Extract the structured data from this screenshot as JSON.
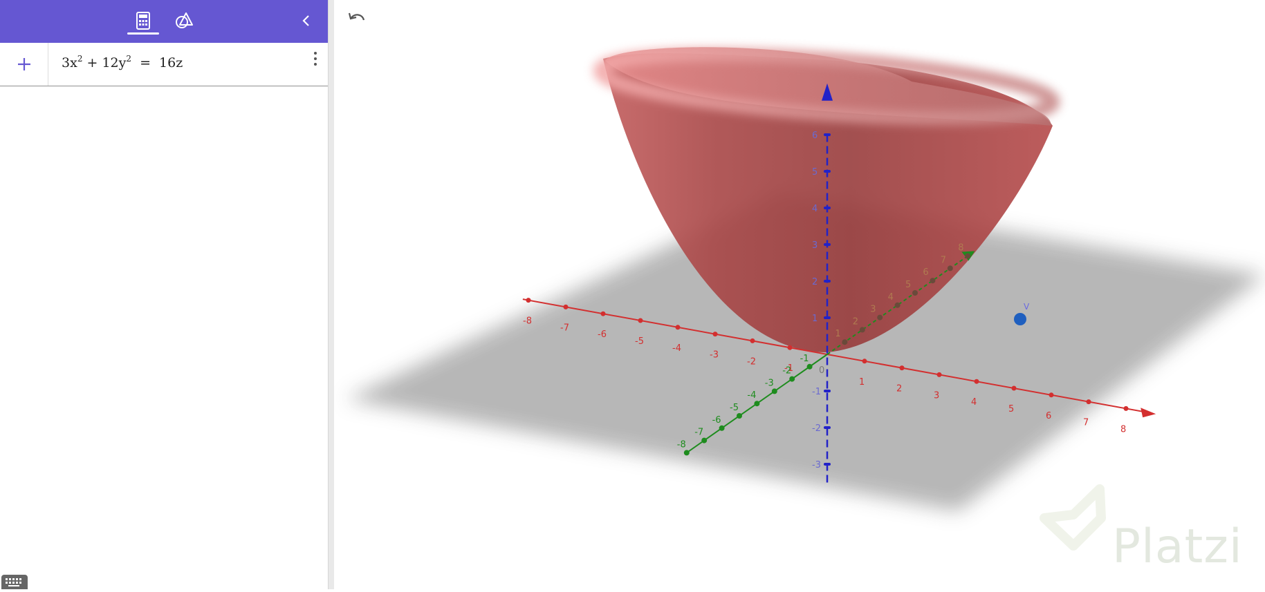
{
  "toolbar": {
    "tabs": [
      {
        "icon": "calculator-icon",
        "active": true
      },
      {
        "icon": "geometry-tools-icon",
        "active": false
      }
    ],
    "collapse_icon": "chevron-left-icon"
  },
  "algebra": {
    "input": {
      "equation": {
        "a": "3x",
        "b": "12y",
        "c": "16z",
        "exp": "2",
        "plus": "+",
        "eq": "="
      }
    }
  },
  "graphics": {
    "undo_icon": "undo-icon",
    "point_label": "V",
    "colors": {
      "x_axis": "#d32f2f",
      "y_axis": "#1e8c1e",
      "z_axis": "#2222c8",
      "surface": "#b84a4a",
      "point": "#1f5fbf",
      "accent": "#6557d2"
    },
    "axes": {
      "x": {
        "labels": [
          "-8",
          "-7",
          "-6",
          "-5",
          "-4",
          "-3",
          "-2",
          "-1",
          "0",
          "1",
          "2",
          "3",
          "4",
          "5",
          "6",
          "7",
          "8"
        ]
      },
      "y": {
        "labels": [
          "-8",
          "-7",
          "-6",
          "-5",
          "-4",
          "-3",
          "-2",
          "-1",
          "1",
          "2",
          "3",
          "4",
          "5",
          "6",
          "7",
          "8"
        ]
      },
      "z": {
        "labels": [
          "-3",
          "-2",
          "-1",
          "1",
          "2",
          "3",
          "4",
          "5",
          "6"
        ]
      }
    }
  },
  "watermark": {
    "text": "Platzi"
  }
}
